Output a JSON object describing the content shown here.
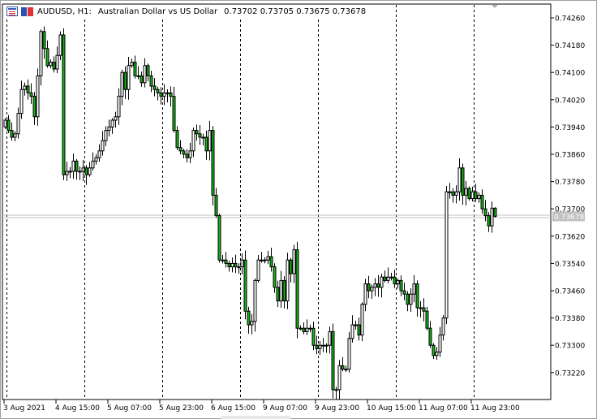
{
  "header": {
    "symbol": "AUDUSD, H1:",
    "description": "Australian Dollar vs US Dollar",
    "ohlc_text": "0.73702 0.73705 0.73675 0.73678"
  },
  "colors": {
    "bull_body": "#ffffff",
    "bear_body": "#16b416",
    "wick": "#000000",
    "bid_line": "#c0c0c0",
    "price_label_bg": "#c0c0c0"
  },
  "chart_data": {
    "type": "candlestick",
    "symbol": "AUDUSD",
    "timeframe": "H1",
    "ylim": [
      0.7319,
      0.743
    ],
    "y_ticks": [
      "0.74260",
      "0.74180",
      "0.74100",
      "0.74020",
      "0.73940",
      "0.73860",
      "0.73780",
      "0.73700",
      "0.73620",
      "0.73540",
      "0.73460",
      "0.73380",
      "0.73300",
      "0.73220"
    ],
    "x_tick_labels": [
      {
        "label": "3 Aug 2021",
        "bar": 0
      },
      {
        "label": "4 Aug 15:00",
        "bar": 16
      },
      {
        "label": "5 Aug 07:00",
        "bar": 32
      },
      {
        "label": "5 Aug 23:00",
        "bar": 48
      },
      {
        "label": "6 Aug 15:00",
        "bar": 64
      },
      {
        "label": "9 Aug 07:00",
        "bar": 80
      },
      {
        "label": "9 Aug 23:00",
        "bar": 96
      },
      {
        "label": "10 Aug 15:00",
        "bar": 112
      },
      {
        "label": "11 Aug 07:00",
        "bar": 128
      },
      {
        "label": "11 Aug 23:00",
        "bar": 144
      }
    ],
    "day_separators_bars": [
      0,
      24,
      48,
      72,
      96,
      120,
      144
    ],
    "current_price": "0.73678",
    "last_bar": {
      "open": 0.73702,
      "high": 0.73705,
      "low": 0.73675,
      "close": 0.73678
    },
    "first_open": 0.7394,
    "closes": [
      0.7396,
      0.7393,
      0.7391,
      0.7392,
      0.7398,
      0.7405,
      0.7406,
      0.7404,
      0.7403,
      0.7397,
      0.7409,
      0.7422,
      0.7417,
      0.7412,
      0.7413,
      0.7411,
      0.7415,
      0.7421,
      0.738,
      0.7381,
      0.7381,
      0.7384,
      0.7381,
      0.7381,
      0.7382,
      0.738,
      0.7382,
      0.7384,
      0.7385,
      0.7387,
      0.739,
      0.7393,
      0.7394,
      0.7396,
      0.7397,
      0.7403,
      0.741,
      0.7405,
      0.7412,
      0.7413,
      0.7409,
      0.7409,
      0.7407,
      0.7412,
      0.7409,
      0.7406,
      0.7405,
      0.7404,
      0.7403,
      0.7404,
      0.7404,
      0.7403,
      0.7393,
      0.7388,
      0.7387,
      0.7386,
      0.7385,
      0.7387,
      0.7393,
      0.7392,
      0.7391,
      0.7391,
      0.7387,
      0.7393,
      0.7374,
      0.7368,
      0.7355,
      0.7355,
      0.7354,
      0.7353,
      0.7354,
      0.7353,
      0.7353,
      0.7355,
      0.734,
      0.7336,
      0.7337,
      0.7349,
      0.7355,
      0.7355,
      0.7355,
      0.7356,
      0.7353,
      0.7347,
      0.7343,
      0.7349,
      0.7343,
      0.7355,
      0.7351,
      0.7358,
      0.7335,
      0.7335,
      0.7334,
      0.7335,
      0.7335,
      0.733,
      0.7329,
      0.733,
      0.733,
      0.733,
      0.7334,
      0.7317,
      0.7317,
      0.7324,
      0.7323,
      0.7323,
      0.7332,
      0.7336,
      0.7336,
      0.7333,
      0.7342,
      0.7348,
      0.7346,
      0.7347,
      0.7348,
      0.7347,
      0.735,
      0.7349,
      0.735,
      0.735,
      0.7348,
      0.7349,
      0.7346,
      0.7345,
      0.7342,
      0.7345,
      0.7348,
      0.7341,
      0.7341,
      0.734,
      0.7335,
      0.733,
      0.7327,
      0.7328,
      0.7333,
      0.7338,
      0.7375,
      0.7375,
      0.7374,
      0.7375,
      0.7382,
      0.7374,
      0.7376,
      0.7373,
      0.7375,
      0.7373,
      0.7374,
      0.737,
      0.7368,
      0.7365,
      0.73702,
      0.73678
    ]
  }
}
